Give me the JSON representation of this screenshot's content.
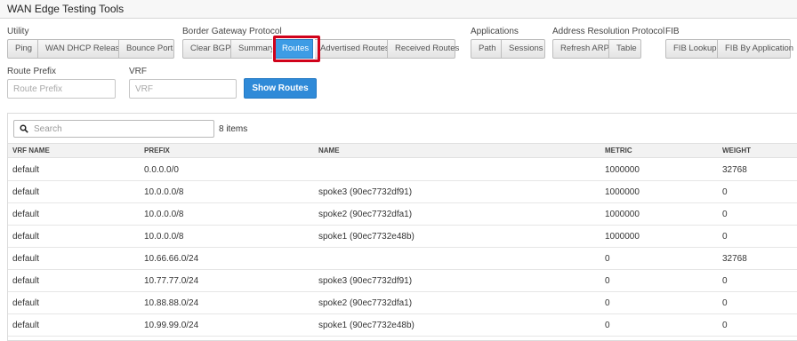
{
  "header": {
    "title": "WAN Edge Testing Tools"
  },
  "groups": {
    "utility": {
      "label": "Utility",
      "buttons": [
        "Ping",
        "WAN DHCP Release",
        "Bounce Port"
      ]
    },
    "bgp": {
      "label": "Border Gateway Protocol",
      "buttons": [
        "Clear BGP",
        "Summary",
        "Routes",
        "Advertised Routes",
        "Received Routes"
      ]
    },
    "applications": {
      "label": "Applications",
      "buttons": [
        "Path",
        "Sessions"
      ]
    },
    "arp": {
      "label": "Address Resolution Protocol",
      "buttons": [
        "Refresh ARP",
        "Table"
      ]
    },
    "fib": {
      "label": "FIB",
      "buttons": [
        "FIB Lookup",
        "FIB By Application"
      ]
    }
  },
  "selected_tool": "Routes",
  "form": {
    "route_prefix_label": "Route Prefix",
    "route_prefix_placeholder": "Route Prefix",
    "vrf_label": "VRF",
    "vrf_placeholder": "VRF",
    "show_routes": "Show Routes"
  },
  "results": {
    "search_placeholder": "Search",
    "count": "8 items",
    "columns": [
      "VRF NAME",
      "PREFIX",
      "NAME",
      "METRIC",
      "WEIGHT"
    ],
    "rows": [
      [
        "default",
        "0.0.0.0/0",
        "",
        "1000000",
        "32768"
      ],
      [
        "default",
        "10.0.0.0/8",
        "spoke3 (90ec7732df91)",
        "1000000",
        "0"
      ],
      [
        "default",
        "10.0.0.0/8",
        "spoke2 (90ec7732dfa1)",
        "1000000",
        "0"
      ],
      [
        "default",
        "10.0.0.0/8",
        "spoke1 (90ec7732e48b)",
        "1000000",
        "0"
      ],
      [
        "default",
        "10.66.66.0/24",
        "",
        "0",
        "32768"
      ],
      [
        "default",
        "10.77.77.0/24",
        "spoke3 (90ec7732df91)",
        "0",
        "0"
      ],
      [
        "default",
        "10.88.88.0/24",
        "spoke2 (90ec7732dfa1)",
        "0",
        "0"
      ],
      [
        "default",
        "10.99.99.0/24",
        "spoke1 (90ec7732e48b)",
        "0",
        "0"
      ]
    ]
  }
}
